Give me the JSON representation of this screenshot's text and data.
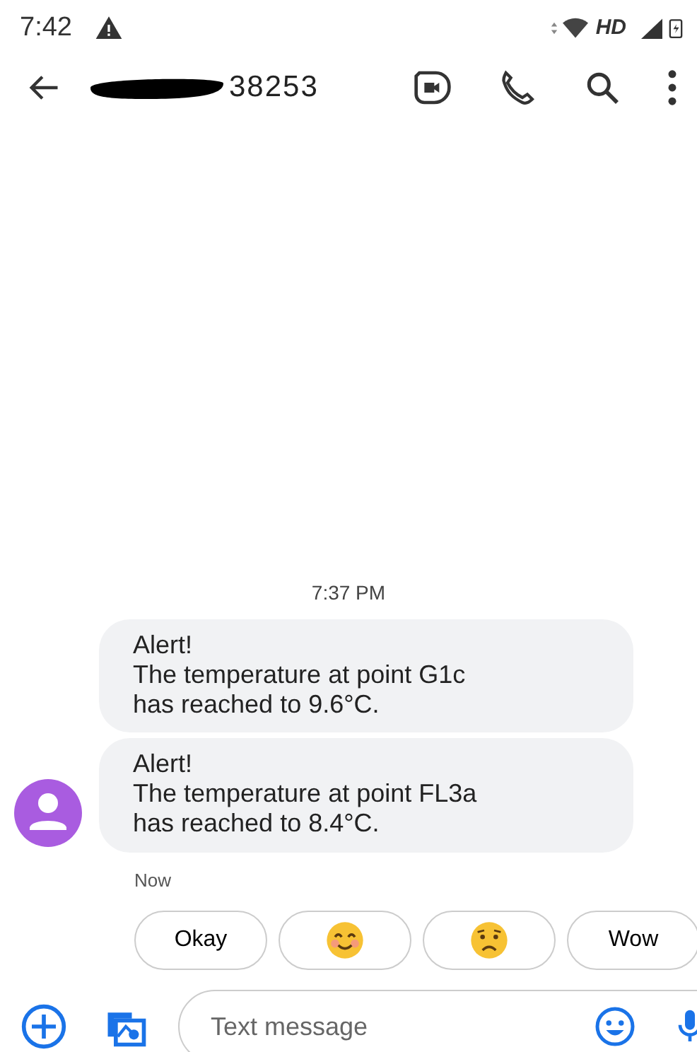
{
  "status_bar": {
    "time": "7:42",
    "network": "HD"
  },
  "toolbar": {
    "contact": "38253"
  },
  "conversation": {
    "timestamp": "7:37 PM",
    "messages": [
      {
        "text": "Alert!\nThe temperature at point G1c\nhas reached to 9.6°C.",
        "show_avatar": false
      },
      {
        "text": "Alert!\nThe temperature at point FL3a\nhas reached to 8.4°C.",
        "show_avatar": true
      }
    ],
    "message_time": "Now"
  },
  "suggestions": [
    {
      "kind": "text",
      "label": "Okay"
    },
    {
      "kind": "smiling_emoji"
    },
    {
      "kind": "worried_emoji"
    },
    {
      "kind": "text",
      "label": "Wow"
    }
  ],
  "composer": {
    "placeholder": "Text message"
  }
}
